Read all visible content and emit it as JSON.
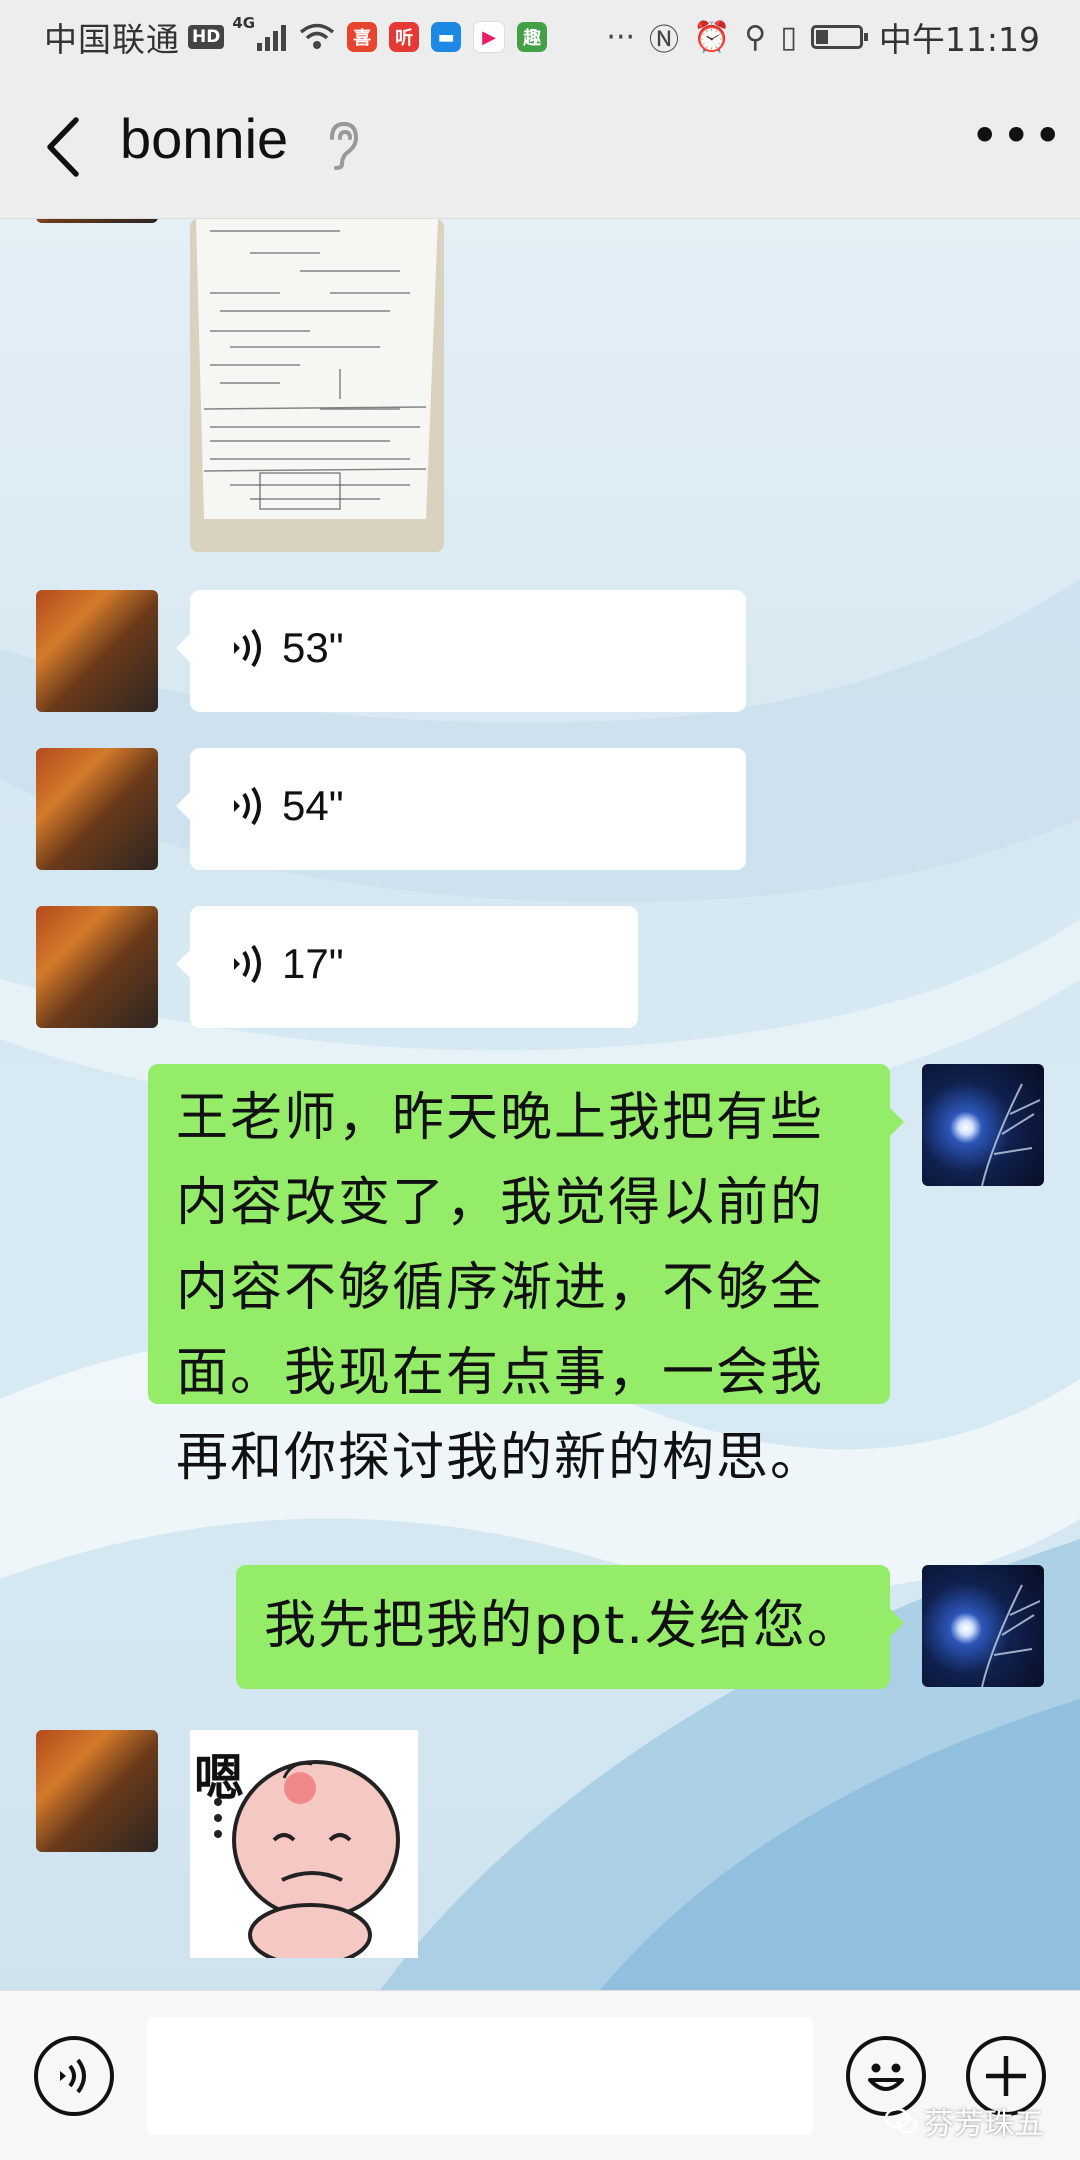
{
  "status_bar": {
    "carrier": "中国联通",
    "hd": "HD",
    "network": "4G",
    "apps": [
      "喜",
      "听",
      "",
      "",
      "趣"
    ],
    "time": "中午11:19"
  },
  "header": {
    "title": "bonnie"
  },
  "messages": {
    "voice_1": "53\"",
    "voice_2": "54\"",
    "voice_3": "17\"",
    "text_1": "王老师，昨天晚上我把有些内容改变了，我觉得以前的内容不够循序渐进，不够全面。我现在有点事，一会我再和你探讨我的新的构思。",
    "text_2": "我先把我的ppt.发给您。",
    "sticker_text": "嗯"
  },
  "input": {
    "value": ""
  },
  "watermark": "芬芳珠五",
  "colors": {
    "sent_bubble": "#95ec69",
    "received_bubble": "#ffffff",
    "bar_background": "#ededed"
  },
  "icons": [
    "back-arrow-icon",
    "ear-icon",
    "more-icon",
    "voice-icon",
    "emoji-icon",
    "plus-icon"
  ]
}
